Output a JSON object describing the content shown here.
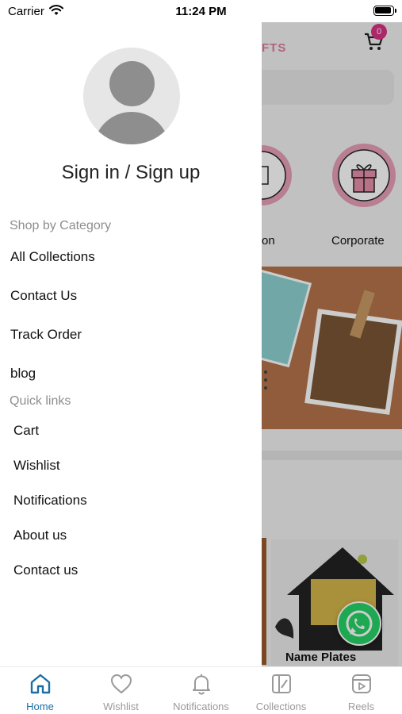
{
  "status_bar": {
    "carrier": "Carrier",
    "time": "11:24 PM"
  },
  "background_app": {
    "logo_fragment": "FTS",
    "cart_count": "0",
    "categories": [
      {
        "label": "on"
      },
      {
        "label": "Corporate"
      }
    ],
    "product_label": "Name Plates"
  },
  "drawer": {
    "signin_label": "Sign in / Sign up",
    "shop_section_title": "Shop by Category",
    "shop_items": [
      {
        "label": "All Collections"
      },
      {
        "label": "Contact Us"
      },
      {
        "label": "Track Order"
      },
      {
        "label": "blog"
      }
    ],
    "quick_section_title": "Quick links",
    "quick_items": [
      {
        "label": "Cart"
      },
      {
        "label": "Wishlist"
      },
      {
        "label": "Notifications"
      },
      {
        "label": "About us"
      },
      {
        "label": "Contact us"
      }
    ]
  },
  "tab_bar": {
    "active_color": "#1c6ea4",
    "inactive_color": "#9a9a9a",
    "tabs": [
      {
        "label": "Home",
        "icon": "home-icon",
        "active": true
      },
      {
        "label": "Wishlist",
        "icon": "heart-icon",
        "active": false
      },
      {
        "label": "Notifications",
        "icon": "bell-icon",
        "active": false
      },
      {
        "label": "Collections",
        "icon": "collections-icon",
        "active": false
      },
      {
        "label": "Reels",
        "icon": "reels-icon",
        "active": false
      }
    ]
  }
}
